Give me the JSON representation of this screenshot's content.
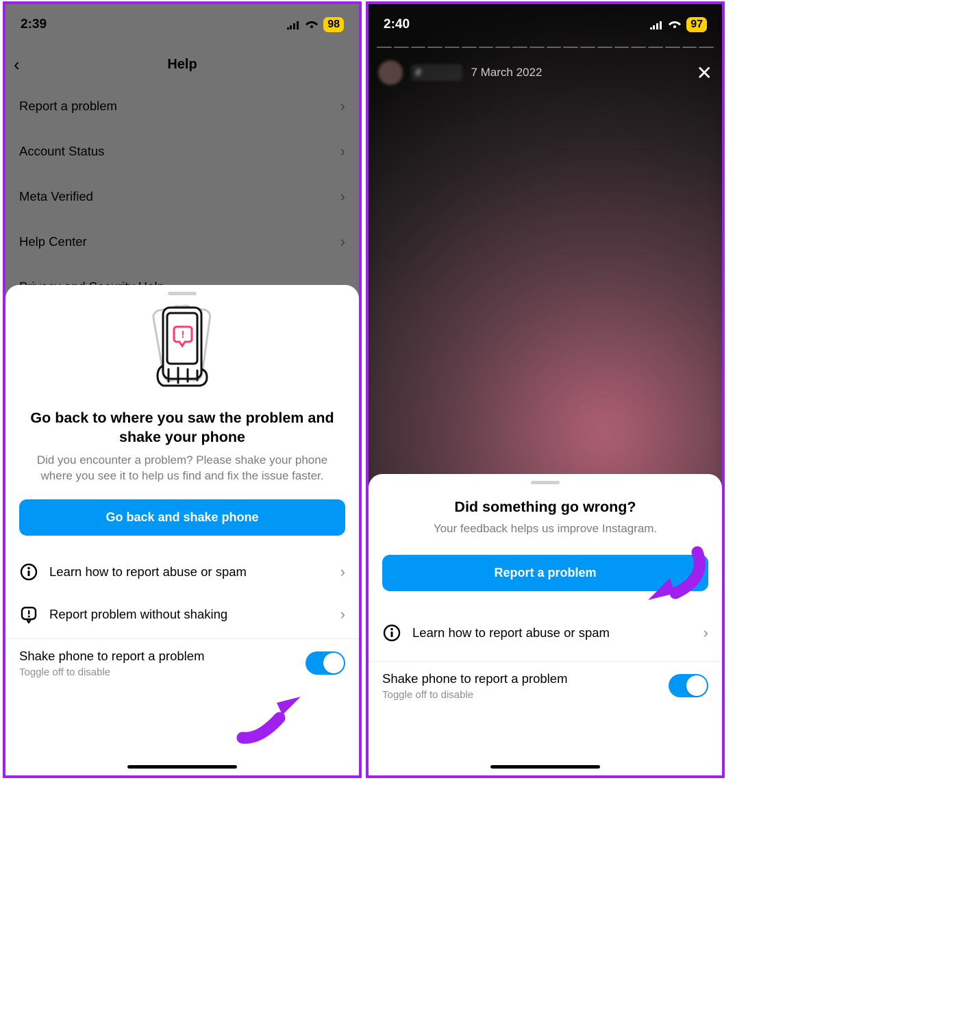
{
  "left": {
    "status_time": "2:39",
    "battery": "98",
    "nav_title": "Help",
    "help_items": [
      "Report a problem",
      "Account Status",
      "Meta Verified",
      "Help Center",
      "Privacy and Security Help"
    ],
    "sheet": {
      "title": "Go back to where you saw the problem and shake your phone",
      "subtitle": "Did you encounter a problem? Please shake your phone where you see it to help us find and fix the issue faster.",
      "primary_label": "Go back and shake phone",
      "rows": [
        "Learn how to report abuse or spam",
        "Report problem without shaking"
      ],
      "toggle_title": "Shake phone to report a problem",
      "toggle_sub": "Toggle off to disable"
    }
  },
  "right": {
    "status_time": "2:40",
    "battery": "97",
    "story_handle": "#",
    "story_time": "7 March 2022",
    "sheet": {
      "title": "Did something go wrong?",
      "subtitle": "Your feedback helps us improve Instagram.",
      "primary_label": "Report a problem",
      "rows": [
        "Learn how to report abuse or spam"
      ],
      "toggle_title": "Shake phone to report a problem",
      "toggle_sub": "Toggle off to disable"
    }
  }
}
